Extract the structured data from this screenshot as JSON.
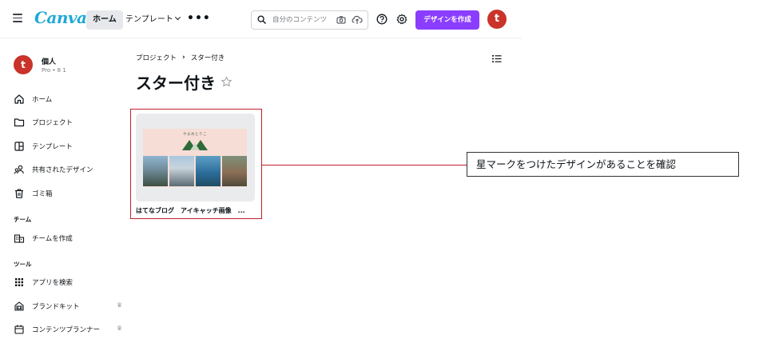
{
  "topbar": {
    "logo": "Canva",
    "nav_home": "ホーム",
    "nav_templates": "テンプレート",
    "nav_more": "•••",
    "search_placeholder": "自分のコンテンツ",
    "create_button": "デザインを作成",
    "avatar_letter": "t"
  },
  "sidebar": {
    "user": {
      "avatar_letter": "t",
      "name": "個人",
      "plan": "Pro • 8 1"
    },
    "items": [
      {
        "label": "ホーム",
        "icon": "home-icon"
      },
      {
        "label": "プロジェクト",
        "icon": "folder-icon"
      },
      {
        "label": "テンプレート",
        "icon": "template-icon"
      },
      {
        "label": "共有されたデザイン",
        "icon": "shared-icon"
      },
      {
        "label": "ゴミ箱",
        "icon": "trash-icon"
      }
    ],
    "team_header": "チーム",
    "team_items": [
      {
        "label": "チームを作成",
        "icon": "building-icon"
      }
    ],
    "tools_header": "ツール",
    "tool_items": [
      {
        "label": "アプリを検索",
        "icon": "apps-grid-icon",
        "crown": false
      },
      {
        "label": "ブランドキット",
        "icon": "brand-kit-icon",
        "crown": true
      },
      {
        "label": "コンテンツプランナー",
        "icon": "calendar-icon",
        "crown": true
      }
    ]
  },
  "main": {
    "breadcrumb": {
      "root": "プロジェクト",
      "current": "スター付き"
    },
    "title": "スター付き",
    "cards": [
      {
        "title": "はてなブログ　アイキャッチ画像　...",
        "thumbnail_caption": "やまめとりこ"
      }
    ]
  },
  "annotation": {
    "text": "星マークをつけたデザインがあることを確認"
  },
  "colors": {
    "accent": "#8b3dff",
    "avatar": "#c9332a",
    "logo": "#1fa9d6",
    "annotation_border": "#c0202a"
  }
}
